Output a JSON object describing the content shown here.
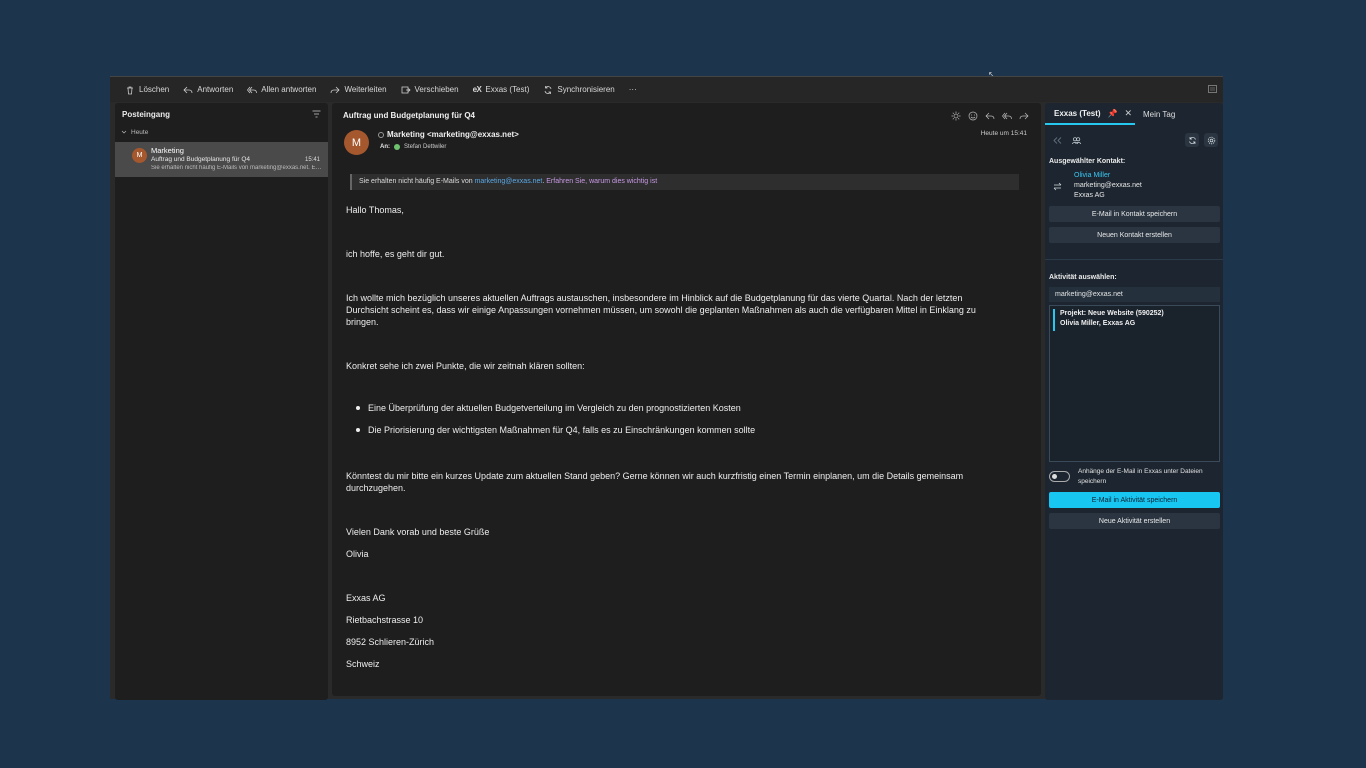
{
  "toolbar": {
    "delete": "Löschen",
    "reply": "Antworten",
    "reply_all": "Allen antworten",
    "forward": "Weiterleiten",
    "move": "Verschieben",
    "exxas_logo": "eX",
    "exxas": "Exxas (Test)",
    "sync": "Synchronisieren",
    "more": "···"
  },
  "folders": {
    "title": "Posteingang",
    "group": "Heute",
    "item": {
      "avatar": "M",
      "sender": "Marketing",
      "subject": "Auftrag und Budgetplanung für Q4",
      "time": "15:41",
      "preview": "Sie erhalten nicht häufig E-Mails von marketing@exxas.net. Erfahren Sie, warum dies wichtig ist"
    }
  },
  "message": {
    "subject": "Auftrag und Budgetplanung für Q4",
    "avatar": "M",
    "from": "Marketing <marketing@exxas.net>",
    "to_label": "An:",
    "to": "Stefan Dettwiler",
    "date": "Heute um 15:41",
    "notice_pre": "Sie erhalten nicht häufig E-Mails von ",
    "notice_link": "marketing@exxas.net",
    "notice_mid": ". ",
    "notice_why": "Erfahren Sie, warum dies wichtig ist",
    "greeting": "Hallo Thomas,",
    "p1": "ich hoffe, es geht dir gut.",
    "p2": "Ich wollte mich bezüglich unseres aktuellen Auftrags austauschen, insbesondere im Hinblick auf die Budgetplanung für das vierte Quartal. Nach der letzten Durchsicht scheint es, dass wir einige Anpassungen vornehmen müssen, um sowohl die geplanten Maßnahmen als auch die verfügbaren Mittel in Einklang zu bringen.",
    "p3": "Konkret sehe ich zwei Punkte, die wir zeitnah klären sollten:",
    "bullets": [
      "Eine Überprüfung der aktuellen Budgetverteilung im Vergleich zu den prognostizierten Kosten",
      "Die Priorisierung der wichtigsten Maßnahmen für Q4, falls es zu Einschränkungen kommen sollte"
    ],
    "p4": "Könntest du mir bitte ein kurzes Update zum aktuellen Stand geben? Gerne können wir auch kurzfristig einen Termin einplanen, um die Details gemeinsam durchzugehen.",
    "closing": "Vielen Dank vorab und beste Grüße",
    "name": "Olivia",
    "sig_company": "Exxas AG",
    "sig_street": "Rietbachstrasse 10",
    "sig_city": "8952 Schlieren-Zürich",
    "sig_country": "Schweiz"
  },
  "addin": {
    "tab_active": "Exxas (Test)",
    "tab_other": "Mein Tag",
    "contact_label": "Ausgewählter Kontakt:",
    "contact_name": "Olivia Miller",
    "contact_email": "marketing@exxas.net",
    "contact_company": "Exxas AG",
    "btn_save_contact": "E-Mail in Kontakt speichern",
    "btn_new_contact": "Neuen Kontakt erstellen",
    "activity_label": "Aktivität auswählen:",
    "activity_select": "marketing@exxas.net",
    "activity_item_line1": "Projekt: Neue Website (590252)",
    "activity_item_line2": "Olivia Miller, Exxas AG",
    "toggle_label": "Anhänge der E-Mail in Exxas unter Dateien speichern",
    "btn_save_activity": "E-Mail in Aktivität speichern",
    "btn_new_activity": "Neue Aktivität erstellen"
  },
  "colors": {
    "background": "#1c344c",
    "accent": "#18c6f2",
    "link": "#5aa8e6",
    "avatar": "#a5582e"
  }
}
